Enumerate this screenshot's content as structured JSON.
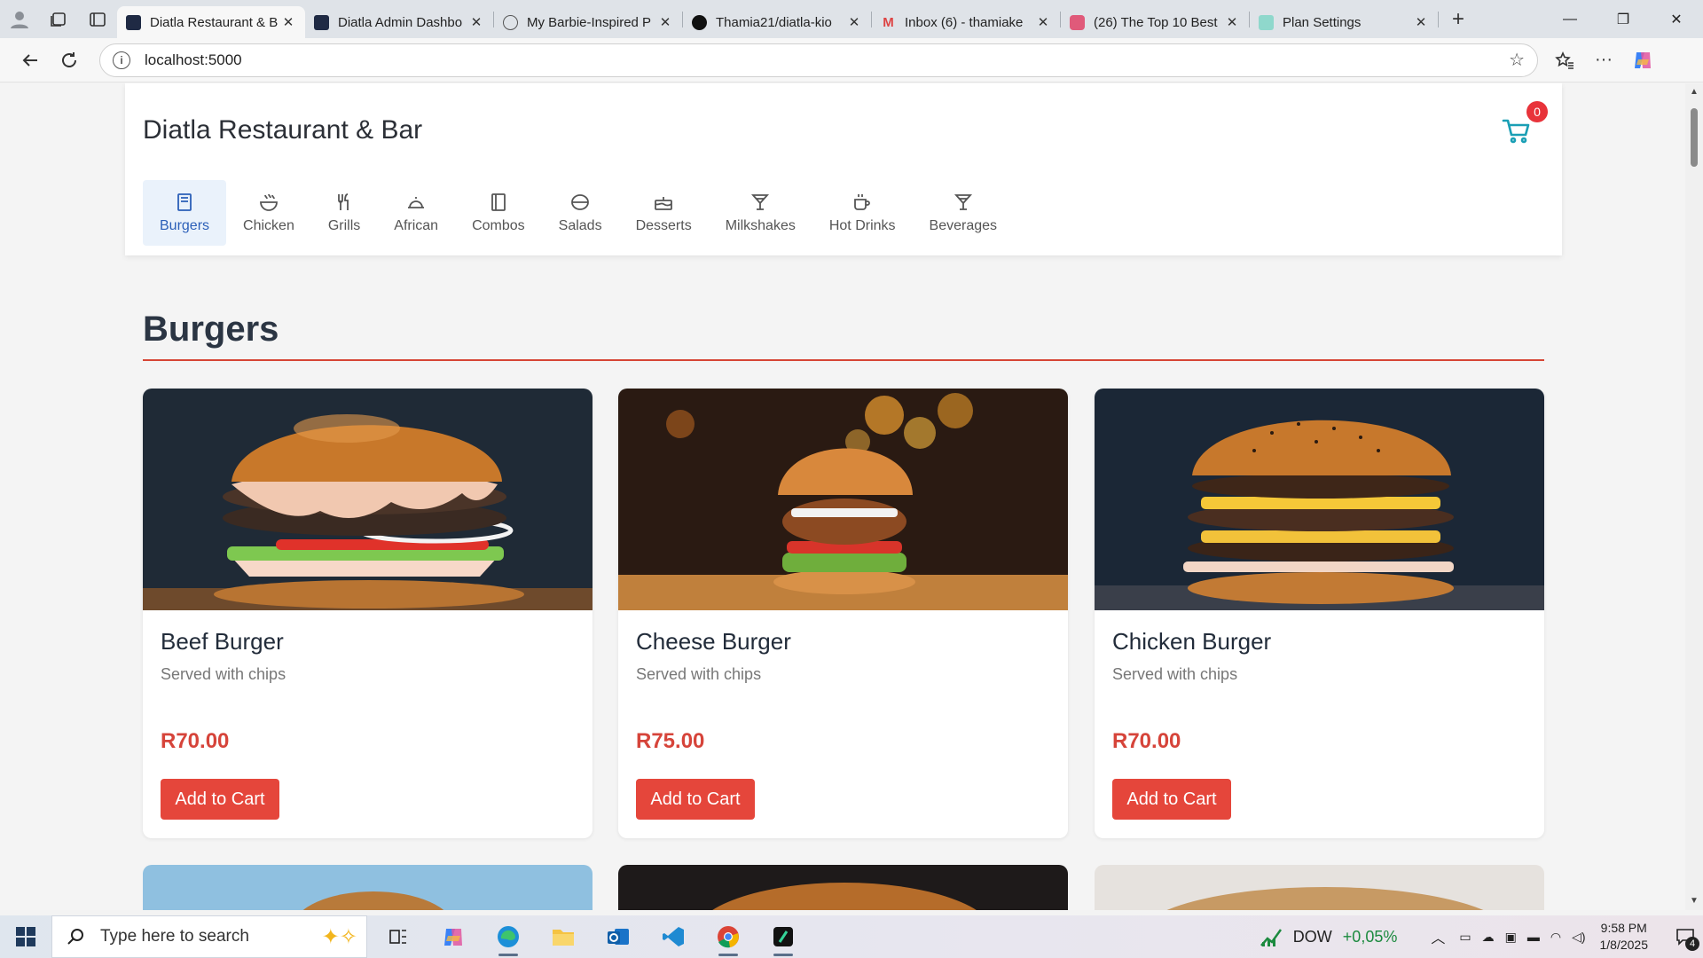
{
  "browser": {
    "tabs": [
      {
        "title": "Diatla Restaurant & B",
        "active": true
      },
      {
        "title": "Diatla Admin Dashbo",
        "active": false
      },
      {
        "title": "My Barbie-Inspired P",
        "active": false
      },
      {
        "title": "Thamia21/diatla-kio",
        "active": false
      },
      {
        "title": "Inbox (6) - thamiake",
        "active": false
      },
      {
        "title": "(26) The Top 10 Best",
        "active": false
      },
      {
        "title": "Plan Settings",
        "active": false
      }
    ],
    "url": "localhost:5000"
  },
  "header": {
    "brand": "Diatla Restaurant & Bar",
    "cart_count": "0"
  },
  "categories": [
    {
      "label": "Burgers",
      "icon": "menu-book-icon",
      "active": true
    },
    {
      "label": "Chicken",
      "icon": "bowl-icon",
      "active": false
    },
    {
      "label": "Grills",
      "icon": "utensils-icon",
      "active": false
    },
    {
      "label": "African",
      "icon": "cloche-icon",
      "active": false
    },
    {
      "label": "Combos",
      "icon": "book-icon",
      "active": false
    },
    {
      "label": "Salads",
      "icon": "salad-bowl-icon",
      "active": false
    },
    {
      "label": "Desserts",
      "icon": "cake-icon",
      "active": false
    },
    {
      "label": "Milkshakes",
      "icon": "cocktail-icon",
      "active": false
    },
    {
      "label": "Hot Drinks",
      "icon": "coffee-cup-icon",
      "active": false
    },
    {
      "label": "Beverages",
      "icon": "cocktail-icon",
      "active": false
    }
  ],
  "section": {
    "title": "Burgers"
  },
  "products": [
    {
      "name": "Beef Burger",
      "description": "Served with chips",
      "price": "R70.00",
      "button": "Add to Cart"
    },
    {
      "name": "Cheese Burger",
      "description": "Served with chips",
      "price": "R75.00",
      "button": "Add to Cart"
    },
    {
      "name": "Chicken Burger",
      "description": "Served with chips",
      "price": "R70.00",
      "button": "Add to Cart"
    }
  ],
  "taskbar": {
    "search_placeholder": "Type here to search",
    "ticker": "DOW",
    "ticker_change": "+0,05%",
    "time": "9:58 PM",
    "date": "1/8/2025",
    "notifications": "4"
  },
  "colors": {
    "accent": "#e5463b",
    "active_tab": "#2b5fb8",
    "cart": "#1a9fb5"
  }
}
